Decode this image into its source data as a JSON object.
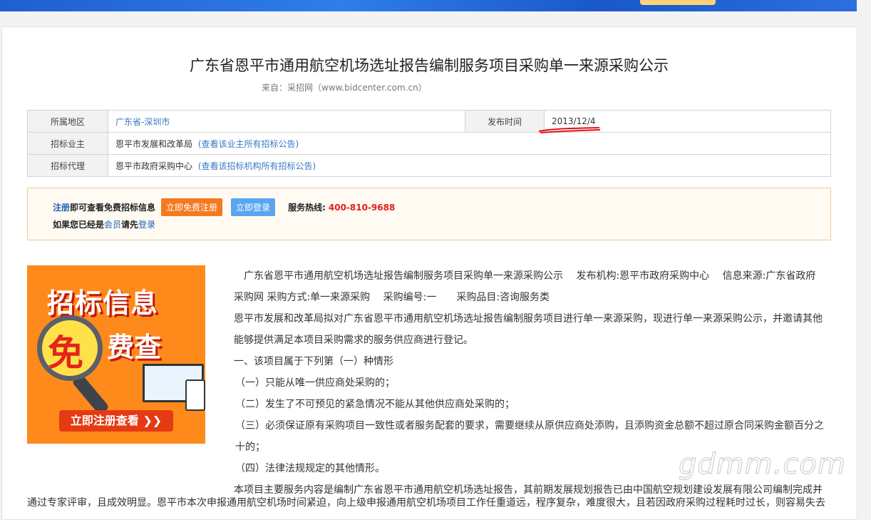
{
  "page": {
    "title": "广东省恩平市通用航空机场选址报告编制服务项目采购单一来源采购公示",
    "source": "来自：采招网（www.bidcenter.com.cn）"
  },
  "meta_table": {
    "region_label": "所属地区",
    "region_value": "广东省-深圳市",
    "publish_label": "发布时间",
    "publish_value": "2013/12/4",
    "owner_label": "招标业主",
    "owner_value": "恩平市发展和改革局",
    "owner_link": "(查看该业主所有招标公告)",
    "agent_label": "招标代理",
    "agent_value": "恩平市政府采购中心",
    "agent_link": "(查看该招标机构所有招标公告)"
  },
  "notice": {
    "register_link": "注册",
    "line1_text": "即可查看免费招标信息",
    "register_button": "立即免费注册",
    "login_button": "立即登录",
    "hotline_label": "服务热线:",
    "hotline_number": "400-810-9688",
    "line2_prefix": "如果您已经是",
    "member_link": "会员",
    "line2_mid": "请先",
    "login_link": "登录"
  },
  "ad": {
    "line1": "招标信息",
    "badge": "免",
    "line2": "费查",
    "cta": "立即注册查看 ❯❯"
  },
  "content": {
    "p1": "　广东省恩平市通用航空机场选址报告编制服务项目采购单一来源采购公示　 发布机构:恩平市政府采购中心　 信息来源:广东省政府采购网 采购方式:单一来源采购　 采购编号:一　　采购品目:咨询服务类",
    "p2": "恩平市发展和改革局拟对广东省恩平市通用航空机场选址报告编制服务项目进行单一来源采购，现进行单一来源采购公示，并邀请其他能够提供满足本项目采购需求的服务供应商进行登记。",
    "p3": "一、该项目属于下列第（一）种情形",
    "p4": "（一）只能从唯一供应商处采购的；",
    "p5": "（二）发生了不可预见的紧急情况不能从其他供应商处采购的；",
    "p6": "（三）必须保证原有采购项目一致性或者服务配套的要求，需要继续从原供应商处添购，且添购资金总额不超过原合同采购金额百分之十的；",
    "p7": "（四）法律法规规定的其他情形。",
    "p8": "本项目主要服务内容是编制广东省恩平市通用航空机场选址报告，其前期发展规划报告已由中国航空规划建设发展有限公司编制完成并",
    "p9": "通过专家评审，且成效明显。恩平市本次申报通用航空机场时间紧迫，向上级申报通用航空机场项目工作任重道远，程序复杂，难度很大，且若因政府采购过程耗时过长，则容易失去"
  },
  "watermark": "gdmm.com",
  "colors": {
    "link": "#3a78c3",
    "hotline": "#e21d1d",
    "register_button": "#f47a20",
    "login_button": "#59a6f0"
  }
}
